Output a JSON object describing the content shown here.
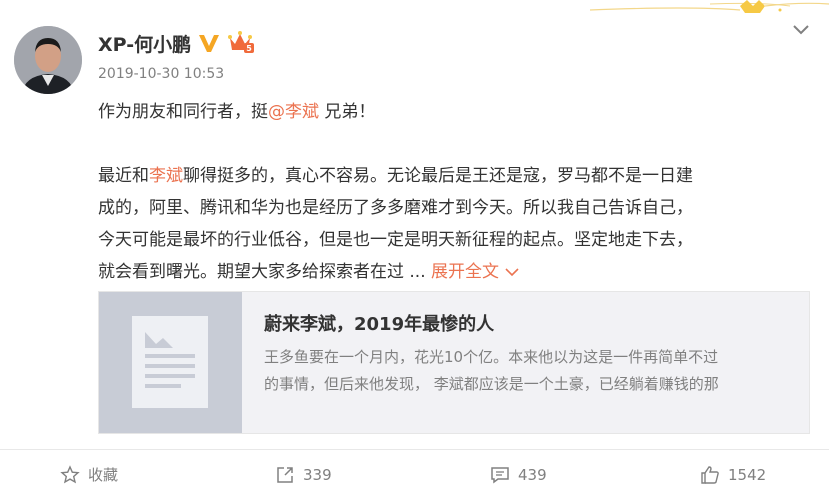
{
  "post": {
    "author": {
      "name": "XP-何小鹏",
      "avatar_icon": "avatar-photo",
      "verified_icon": "verified-v-icon",
      "vip_icon": "vip-crown-icon"
    },
    "timestamp": "2019-10-30 10:53",
    "content": {
      "line1_prefix": "作为朋友和同行者，挺",
      "line1_mention": "@李斌",
      "line1_suffix": " 兄弟！",
      "para2_prefix": "最近和",
      "para2_mention": "李斌",
      "para2_rest": "聊得挺多的，真心不容易。无论最后是王还是寇，罗马都不是一日建",
      "line3": "成的，阿里、腾讯和华为也是经历了多多磨难才到今天。所以我自己告诉自己，",
      "line4": "今天可能是最坏的行业低谷，但是也一定是明天新征程的起点。坚定地走下去，",
      "line5": "就会看到曙光。期望大家多给探索者在过 ...",
      "expand_label": "展开全文"
    },
    "card": {
      "title": "蔚来李斌，2019年最惨的人",
      "desc_line1": "王多鱼要在一个月内，花光10个亿。本来他以为这是一件再简单不过",
      "desc_line2": "的事情，但后来他发现， 李斌都应该是一个土豪，已经躺着赚钱的那"
    },
    "actions": {
      "favorite_label": "收藏",
      "repost_count": "339",
      "comment_count": "439",
      "like_count": "1542"
    }
  },
  "colors": {
    "accent": "#eb7350",
    "muted": "#808080",
    "text": "#333333",
    "card_bg": "#f2f2f5"
  }
}
